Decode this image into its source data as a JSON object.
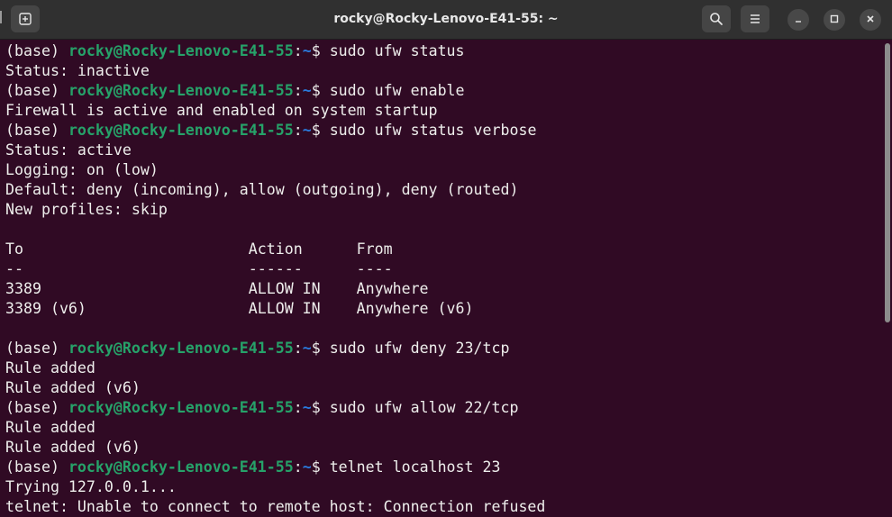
{
  "window": {
    "title": "rocky@Rocky-Lenovo-E41-55: ~"
  },
  "icons": {
    "new_tab": "new-tab-icon",
    "search": "search-icon",
    "menu": "hamburger-menu-icon",
    "minimize": "minimize-icon",
    "maximize": "maximize-icon",
    "close": "close-icon"
  },
  "colors": {
    "background": "#300a24",
    "user_host": "#26a269",
    "path": "#2a7bde",
    "text": "#eeeeec",
    "titlebar": "#303030"
  },
  "terminal": {
    "lines": [
      {
        "kind": "prompt",
        "env": "(base) ",
        "userhost": "rocky@Rocky-Lenovo-E41-55",
        "sep": ":",
        "path": "~",
        "sigil": "$ ",
        "cmd": "sudo ufw status"
      },
      {
        "kind": "out",
        "text": "Status: inactive"
      },
      {
        "kind": "prompt",
        "env": "(base) ",
        "userhost": "rocky@Rocky-Lenovo-E41-55",
        "sep": ":",
        "path": "~",
        "sigil": "$ ",
        "cmd": "sudo ufw enable"
      },
      {
        "kind": "out",
        "text": "Firewall is active and enabled on system startup"
      },
      {
        "kind": "prompt",
        "env": "(base) ",
        "userhost": "rocky@Rocky-Lenovo-E41-55",
        "sep": ":",
        "path": "~",
        "sigil": "$ ",
        "cmd": "sudo ufw status verbose"
      },
      {
        "kind": "out",
        "text": "Status: active"
      },
      {
        "kind": "out",
        "text": "Logging: on (low)"
      },
      {
        "kind": "out",
        "text": "Default: deny (incoming), allow (outgoing), deny (routed)"
      },
      {
        "kind": "out",
        "text": "New profiles: skip"
      },
      {
        "kind": "out",
        "text": ""
      },
      {
        "kind": "out",
        "text": "To                         Action      From"
      },
      {
        "kind": "out",
        "text": "--                         ------      ----"
      },
      {
        "kind": "out",
        "text": "3389                       ALLOW IN    Anywhere"
      },
      {
        "kind": "out",
        "text": "3389 (v6)                  ALLOW IN    Anywhere (v6)"
      },
      {
        "kind": "out",
        "text": ""
      },
      {
        "kind": "prompt",
        "env": "(base) ",
        "userhost": "rocky@Rocky-Lenovo-E41-55",
        "sep": ":",
        "path": "~",
        "sigil": "$ ",
        "cmd": "sudo ufw deny 23/tcp"
      },
      {
        "kind": "out",
        "text": "Rule added"
      },
      {
        "kind": "out",
        "text": "Rule added (v6)"
      },
      {
        "kind": "prompt",
        "env": "(base) ",
        "userhost": "rocky@Rocky-Lenovo-E41-55",
        "sep": ":",
        "path": "~",
        "sigil": "$ ",
        "cmd": "sudo ufw allow 22/tcp"
      },
      {
        "kind": "out",
        "text": "Rule added"
      },
      {
        "kind": "out",
        "text": "Rule added (v6)"
      },
      {
        "kind": "prompt",
        "env": "(base) ",
        "userhost": "rocky@Rocky-Lenovo-E41-55",
        "sep": ":",
        "path": "~",
        "sigil": "$ ",
        "cmd": "telnet localhost 23"
      },
      {
        "kind": "out",
        "text": "Trying 127.0.0.1..."
      },
      {
        "kind": "out",
        "text": "telnet: Unable to connect to remote host: Connection refused"
      }
    ]
  }
}
